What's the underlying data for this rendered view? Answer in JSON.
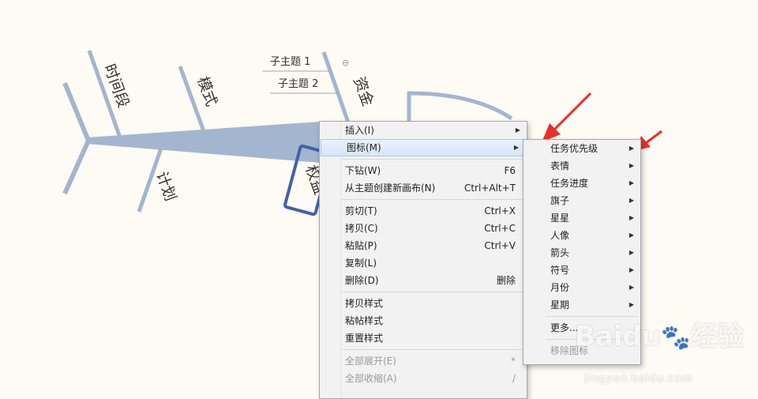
{
  "fishbone": {
    "branches": [
      "时间段",
      "模式",
      "计划",
      "资金"
    ],
    "partial_branch": "权益",
    "subtopics": [
      "子主题 1",
      "子主题 2"
    ],
    "collapse_symbol": "⊖"
  },
  "context_menu": {
    "groups": [
      [
        {
          "label": "插入(I)",
          "shortcut": "",
          "submenu": true,
          "highlighted": false,
          "disabled": false
        },
        {
          "label": "图标(M)",
          "shortcut": "",
          "submenu": true,
          "highlighted": true,
          "disabled": false
        }
      ],
      [
        {
          "label": "下钻(W)",
          "shortcut": "F6",
          "submenu": false,
          "highlighted": false,
          "disabled": false
        },
        {
          "label": "从主题创建新画布(N)",
          "shortcut": "Ctrl+Alt+T",
          "submenu": false,
          "highlighted": false,
          "disabled": false
        }
      ],
      [
        {
          "label": "剪切(T)",
          "shortcut": "Ctrl+X",
          "submenu": false,
          "highlighted": false,
          "disabled": false
        },
        {
          "label": "拷贝(C)",
          "shortcut": "Ctrl+C",
          "submenu": false,
          "highlighted": false,
          "disabled": false
        },
        {
          "label": "粘贴(P)",
          "shortcut": "Ctrl+V",
          "submenu": false,
          "highlighted": false,
          "disabled": false
        },
        {
          "label": "复制(L)",
          "shortcut": "",
          "submenu": false,
          "highlighted": false,
          "disabled": false
        },
        {
          "label": "删除(D)",
          "shortcut": "删除",
          "submenu": false,
          "highlighted": false,
          "disabled": false
        }
      ],
      [
        {
          "label": "拷贝样式",
          "shortcut": "",
          "submenu": false,
          "highlighted": false,
          "disabled": false
        },
        {
          "label": "粘帖样式",
          "shortcut": "",
          "submenu": false,
          "highlighted": false,
          "disabled": false
        },
        {
          "label": "重置样式",
          "shortcut": "",
          "submenu": false,
          "highlighted": false,
          "disabled": false
        }
      ],
      [
        {
          "label": "全部展开(E)",
          "shortcut": "*",
          "submenu": false,
          "highlighted": false,
          "disabled": true
        },
        {
          "label": "全部收缩(A)",
          "shortcut": "/",
          "submenu": false,
          "highlighted": false,
          "disabled": true
        }
      ]
    ]
  },
  "icon_submenu": {
    "items": [
      "任务优先级",
      "表情",
      "任务进度",
      "旗子",
      "星星",
      "人像",
      "箭头",
      "符号",
      "月份",
      "星期"
    ],
    "more": "更多...",
    "remove": "移除图标"
  },
  "watermark": {
    "brand": "Baidu",
    "sub_brand": "经验",
    "url": "jingyan.baidu.com"
  },
  "colors": {
    "background": "#fdfbf3",
    "bone": "#a3b6cf",
    "frame": "#4262a8",
    "arrow": "#e8302a",
    "highlight": "#d7e6f7"
  }
}
